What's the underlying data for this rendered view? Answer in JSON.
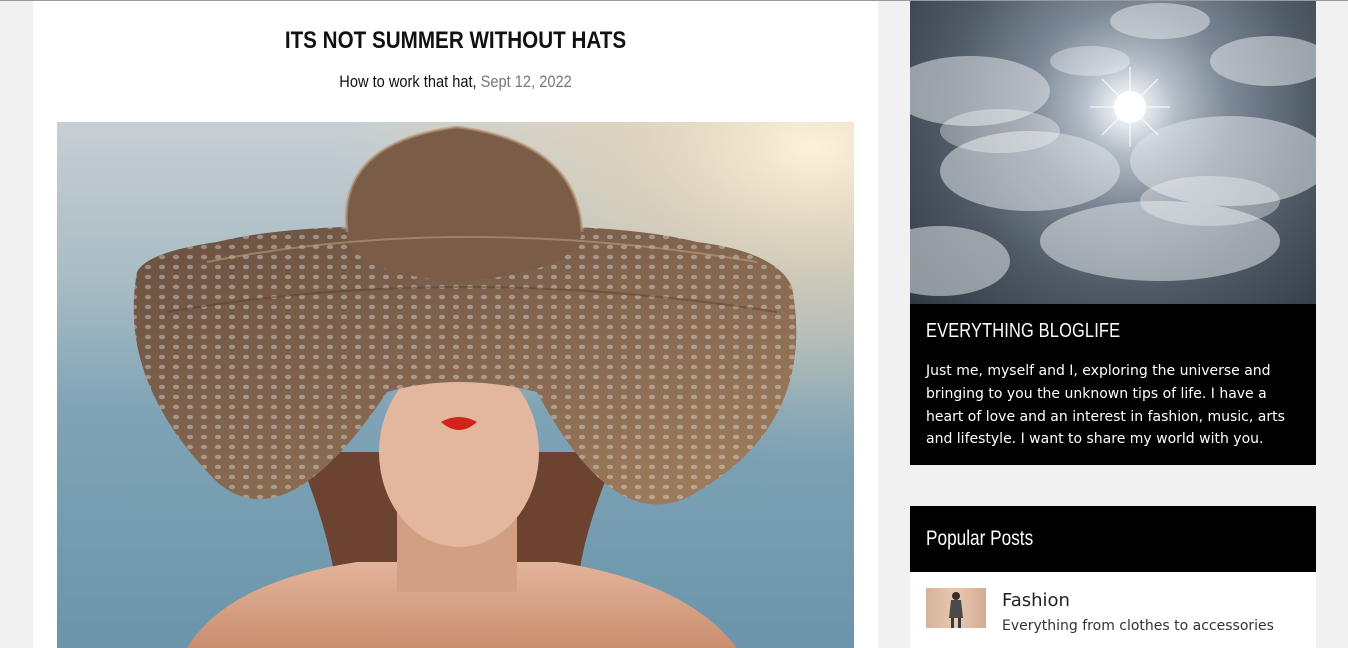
{
  "post": {
    "title": "ITS NOT SUMMER WITHOUT HATS",
    "subtitle": "How to work that hat,",
    "date": "Sept 12, 2022"
  },
  "about": {
    "title": "EVERYTHING BLOGLIFE",
    "text": "Just me, myself and I, exploring the universe and bringing to you the unknown tips of life. I have a heart of love and an interest in fashion, music, arts and lifestyle. I want to share my world with you."
  },
  "popular": {
    "heading": "Popular Posts",
    "items": [
      {
        "name": "Fashion",
        "description": "Everything from clothes to accessories"
      }
    ]
  }
}
